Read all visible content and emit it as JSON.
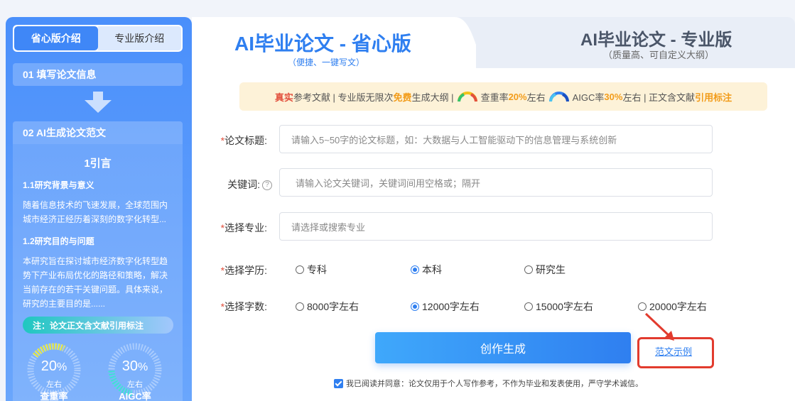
{
  "sidebar": {
    "tabs": [
      {
        "label": "省心版介绍",
        "active": true
      },
      {
        "label": "专业版介绍",
        "active": false
      }
    ],
    "step1": "01 填写论文信息",
    "step2": "02 AI生成论文范文",
    "sample": {
      "chapter": "1引言",
      "sec1_title": "1.1研究背景与意义",
      "sec1_body": "随着信息技术的飞速发展，全球范围内城市经济正经历着深刻的数字化转型...",
      "sec2_title": "1.2研究目的与问题",
      "sec2_body": "本研究旨在探讨城市经济数字化转型趋势下产业布局优化的路径和策略，解决当前存在的若干关键问题。具体来说，研究的主要目的是......",
      "note": "注：论文正文含文献引用标注"
    },
    "gauges": [
      {
        "value": "20",
        "unit": "%",
        "approx": "左右",
        "name": "查重率",
        "color": "#e7e83a"
      },
      {
        "value": "30",
        "unit": "%",
        "approx": "左右",
        "name": "AIGC率",
        "color": "#3de0d3"
      }
    ]
  },
  "header": {
    "title": "AI毕业论文 - 省心版",
    "subtitle": "（便捷、一键写文）",
    "pro_title": "AI毕业论文 - 专业版",
    "pro_subtitle": "（质量高、可自定义大纲）"
  },
  "banner": {
    "t1_red": "真实",
    "t1": "参考文献 | 专业版无限次",
    "t2_red": "免费",
    "t2": "生成大纲 | ",
    "t3": "查重率",
    "t3_org": "20%",
    "t4": "左右 ",
    "t5": "AIGC率",
    "t5_org": "30%",
    "t6": " 左右 | 正文含文献",
    "t6_org": "引用标注"
  },
  "form": {
    "title_label": "论文标题:",
    "title_placeholder": "请输入5~50字的论文标题，如：大数据与人工智能驱动下的信息管理与系统创新",
    "keywords_label": "关键词:",
    "keywords_placeholder": "请输入论文关键词，关键词间用空格或；隔开",
    "major_label": "选择专业:",
    "major_placeholder": "请选择或搜索专业",
    "degree_label": "选择学历:",
    "degree_options": [
      "专科",
      "本科",
      "研究生"
    ],
    "degree_selected": "本科",
    "words_label": "选择字数:",
    "words_options": [
      "8000字左右",
      "12000字左右",
      "15000字左右",
      "20000字左右"
    ],
    "words_selected": "12000字左右",
    "required_mark": "*",
    "help_mark": "?"
  },
  "actions": {
    "generate": "创作生成",
    "sample_link": "范文示例",
    "agree_text": "我已阅读并同意：论文仅用于个人写作参考，不作为毕业和发表使用，严守学术诚信。"
  },
  "colors": {
    "brand": "#2f7ff0",
    "highlight_red": "#e23b2e",
    "banner_bg": "#fdf2d8"
  }
}
